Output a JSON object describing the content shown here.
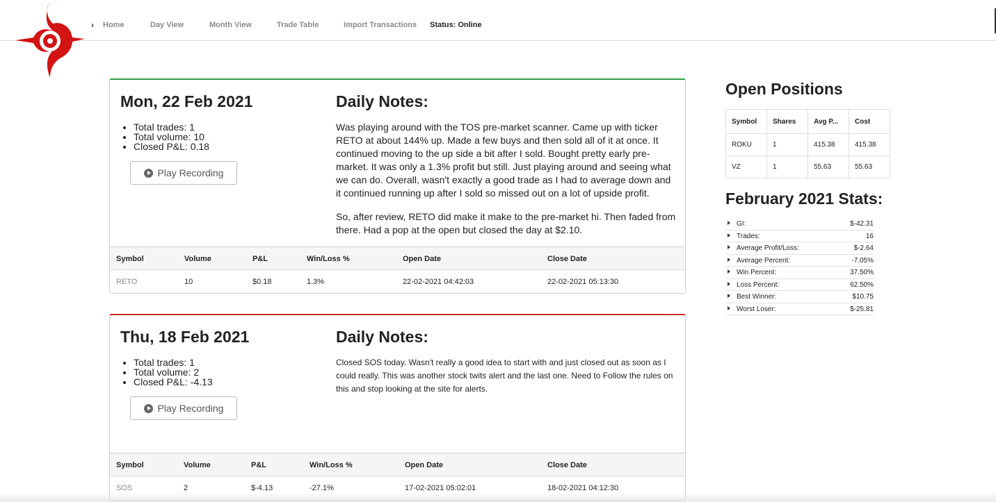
{
  "nav": {
    "items": [
      "Home",
      "Day View",
      "Month View",
      "Trade Table",
      "Import Transactions"
    ],
    "status": "Status: Online"
  },
  "days": [
    {
      "date": "Mon, 22 Feb 2021",
      "accent": "#2e9e46",
      "summary": [
        "Total trades: 1",
        "Total volume: 10",
        "Closed P&L: 0.18"
      ],
      "play_label": "Play Recording",
      "notes_title": "Daily Notes:",
      "notes": [
        "Was playing around with the TOS pre-market scanner. Came up with ticker RETO at about 144% up. Made a few buys and then sold all of it at once. It continued moving to the up side a bit after I sold. Bought pretty early pre-market. It was only a 1.3% profit but still. Just playing around and seeing what we can do. Overall, wasn't exactly a good trade as I had to average down and it continued running up after I sold so missed out on a lot of upside profit.",
        "So, after review, RETO did make it make to the pre-market hi. Then faded from there. Had a pop at the open but closed the day at $2.10."
      ],
      "trade_headers": [
        "Symbol",
        "Volume",
        "P&L",
        "Win/Loss %",
        "Open Date",
        "Close Date"
      ],
      "trades": [
        [
          "RETO",
          "10",
          "$0.18",
          "1.3%",
          "22-02-2021 04:42:03",
          "22-02-2021 05:13:30"
        ]
      ]
    },
    {
      "date": "Thu, 18 Feb 2021",
      "accent": "#cc2a2a",
      "summary": [
        "Total trades: 1",
        "Total volume: 2",
        "Closed P&L: -4.13"
      ],
      "play_label": "Play Recording",
      "notes_title": "Daily Notes:",
      "notes": [
        "Closed SOS today. Wasn't really a good idea to start with and just closed out as soon as I could really. This was another stock twits alert and the last one. Need to Follow the rules on this and stop looking at the site for alerts."
      ],
      "trade_headers": [
        "Symbol",
        "Volume",
        "P&L",
        "Win/Loss %",
        "Open Date",
        "Close Date"
      ],
      "trades": [
        [
          "SOS",
          "2",
          "$-4.13",
          "-27.1%",
          "17-02-2021 05:02:01",
          "18-02-2021 04:12:30"
        ]
      ]
    }
  ],
  "open_positions": {
    "title": "Open Positions",
    "headers": [
      "Symbol",
      "Shares",
      "Avg P...",
      "Cost"
    ],
    "rows": [
      [
        "ROKU",
        "1",
        "415.38",
        "415.38"
      ],
      [
        "VZ",
        "1",
        "55.63",
        "55.63"
      ]
    ]
  },
  "stats": {
    "title": "February 2021 Stats:",
    "items": [
      {
        "label": "GI:",
        "value": "$-42.31"
      },
      {
        "label": "Trades:",
        "value": "16"
      },
      {
        "label": "Average Profit/Loss:",
        "value": "$-2.64"
      },
      {
        "label": "Average Percent:",
        "value": "-7.05%"
      },
      {
        "label": "Win Percent:",
        "value": "37.50%"
      },
      {
        "label": "Loss Percent:",
        "value": "62.50%"
      },
      {
        "label": "Best Winner:",
        "value": "$10.75"
      },
      {
        "label": "Worst Loser:",
        "value": "$-25.81"
      }
    ]
  }
}
